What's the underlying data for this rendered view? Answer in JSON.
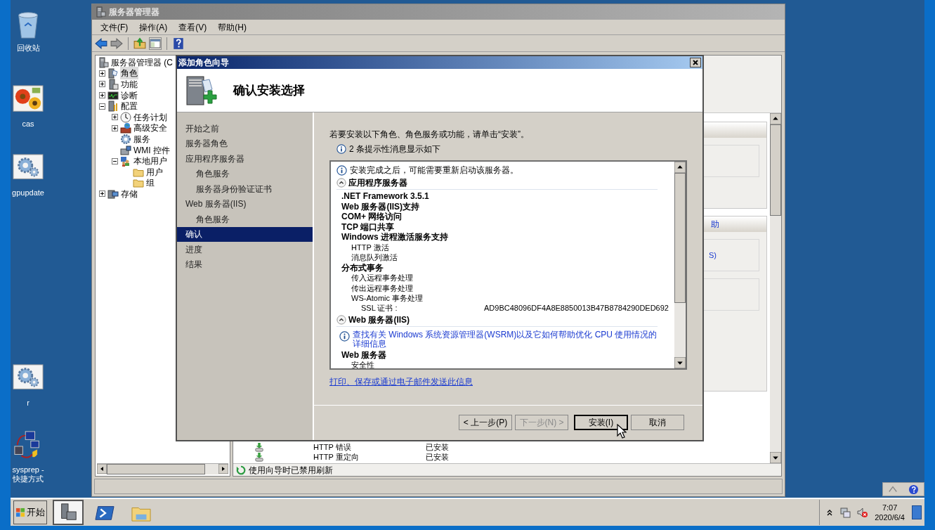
{
  "desktop": {
    "icons": [
      {
        "label": "回收站",
        "kind": "recycle"
      },
      {
        "label": "cas",
        "kind": "flowers"
      },
      {
        "label": "gpupdate",
        "kind": "gears"
      },
      {
        "label": "r",
        "kind": "gears"
      },
      {
        "label": "sysprep - 快捷方式",
        "kind": "network"
      }
    ]
  },
  "server_manager": {
    "title": "服务器管理器",
    "menu": [
      "文件(F)",
      "操作(A)",
      "查看(V)",
      "帮助(H)"
    ],
    "tree": [
      {
        "label": "服务器管理器 (C",
        "kind": "server",
        "selected": false,
        "children": [
          {
            "label": "角色",
            "kind": "roles",
            "expanded": false,
            "selected": true
          },
          {
            "label": "功能",
            "kind": "features",
            "expanded": false,
            "selected": false
          },
          {
            "label": "诊断",
            "kind": "diagnostics",
            "expanded": false,
            "selected": false
          },
          {
            "label": "配置",
            "kind": "config",
            "expanded": true,
            "selected": false,
            "children": [
              {
                "label": "任务计划",
                "kind": "scheduler",
                "expanded": false,
                "selected": false
              },
              {
                "label": "高级安全",
                "kind": "firewall",
                "expanded": false,
                "selected": false
              },
              {
                "label": "服务",
                "kind": "services",
                "selected": false
              },
              {
                "label": "WMI 控件",
                "kind": "wmi",
                "selected": false
              },
              {
                "label": "本地用户",
                "kind": "users",
                "expanded": true,
                "selected": false,
                "children": [
                  {
                    "label": "用户",
                    "kind": "folder",
                    "selected": false
                  },
                  {
                    "label": "组",
                    "kind": "folder",
                    "selected": false
                  }
                ]
              }
            ]
          },
          {
            "label": "存储",
            "kind": "storage",
            "expanded": false,
            "selected": false
          }
        ]
      }
    ],
    "side_links": [
      "助",
      "S)"
    ],
    "list_rows": [
      {
        "name": "HTTP 错误",
        "status": "已安装"
      },
      {
        "name": "HTTP 重定向",
        "status": "已安装"
      }
    ],
    "status_text": "使用向导时已禁用刷新"
  },
  "wizard": {
    "title": "添加角色向导",
    "heading": "确认安装选择",
    "steps": [
      {
        "label": "开始之前",
        "selected": false
      },
      {
        "label": "服务器角色",
        "selected": false
      },
      {
        "label": "应用程序服务器",
        "selected": false,
        "children": [
          {
            "label": "角色服务",
            "selected": false
          },
          {
            "label": "服务器身份验证证书",
            "selected": false
          }
        ]
      },
      {
        "label": "Web 服务器(IIS)",
        "selected": false,
        "children": [
          {
            "label": "角色服务",
            "selected": false
          }
        ]
      },
      {
        "label": "确认",
        "selected": true
      },
      {
        "label": "进度",
        "selected": false
      },
      {
        "label": "结果",
        "selected": false
      }
    ],
    "intro": "若要安装以下角色、角色服务或功能，请单击“安装”。",
    "notice": "2 条提示性消息显示如下",
    "details": [
      {
        "kind": "info",
        "text": "安装完成之后，可能需要重新启动该服务器。"
      },
      {
        "kind": "section",
        "title": "应用程序服务器",
        "expanded": true,
        "items": [
          {
            "kind": "item",
            "text": ".NET Framework 3.5.1"
          },
          {
            "kind": "item",
            "text": "Web 服务器(IIS)支持"
          },
          {
            "kind": "item",
            "text": "COM+ 网络访问"
          },
          {
            "kind": "item",
            "text": "TCP 端口共享"
          },
          {
            "kind": "item",
            "text": "Windows 进程激活服务支持",
            "children": [
              {
                "kind": "item",
                "text": "HTTP 激活"
              },
              {
                "kind": "item",
                "text": "消息队列激活"
              }
            ]
          },
          {
            "kind": "item",
            "text": "分布式事务",
            "children": [
              {
                "kind": "item",
                "text": "传入远程事务处理"
              },
              {
                "kind": "item",
                "text": "传出远程事务处理"
              },
              {
                "kind": "item",
                "text": "WS-Atomic 事务处理",
                "children": [
                  {
                    "kind": "cert",
                    "text": "SSL 证书 :",
                    "value": "AD9BC48096DF4A8E8850013B47B8784290DED692"
                  }
                ]
              }
            ]
          }
        ]
      },
      {
        "kind": "section",
        "title": "Web 服务器(IIS)",
        "expanded": true,
        "items": [
          {
            "kind": "link",
            "text": "查找有关 Windows 系统资源管理器(WSRM)以及它如何帮助优化 CPU 使用情况的详细信息"
          },
          {
            "kind": "item",
            "text": "Web 服务器",
            "children": [
              {
                "kind": "item",
                "text": "安全性"
              }
            ]
          }
        ]
      }
    ],
    "link": "打印、保存或通过电子邮件发送此信息",
    "buttons": [
      {
        "label": "< 上一步(P)",
        "disabled": false,
        "default": false
      },
      {
        "label": "下一步(N) >",
        "disabled": true,
        "default": false
      },
      {
        "label": "安装(I)",
        "disabled": false,
        "default": true
      },
      {
        "label": "取消",
        "disabled": false,
        "default": false
      }
    ]
  },
  "taskbar": {
    "start": "开始",
    "apps": [
      {
        "kind": "server",
        "selected": true
      },
      {
        "kind": "powershell",
        "selected": false
      },
      {
        "kind": "folder",
        "selected": false
      }
    ],
    "time": "7:07",
    "date": "2020/6/4"
  }
}
